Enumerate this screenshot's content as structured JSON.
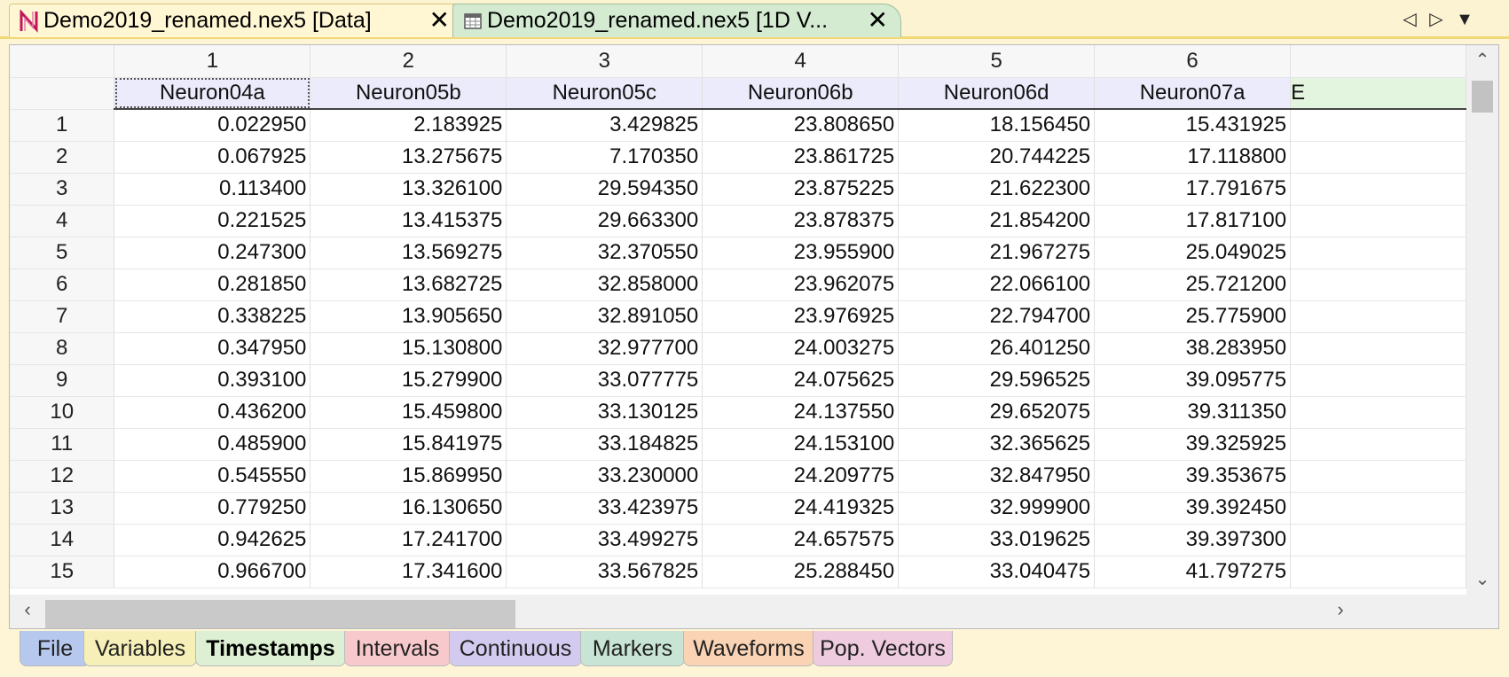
{
  "document_tabs": [
    {
      "label": "Demo2019_renamed.nex5 [Data]",
      "close": "✕",
      "icon": "neuroexplorer-logo-icon"
    },
    {
      "label": "Demo2019_renamed.nex5 [1D V...",
      "close": "✕",
      "icon": "table-window-icon"
    }
  ],
  "tab_nav": {
    "prev": "◁",
    "next": "▷",
    "menu": "▼"
  },
  "grid": {
    "column_numbers": [
      "1",
      "2",
      "3",
      "4",
      "5",
      "6"
    ],
    "column_names": [
      "Neuron04a",
      "Neuron05b",
      "Neuron05c",
      "Neuron06b",
      "Neuron06d",
      "Neuron07a",
      "E"
    ],
    "rows": [
      {
        "n": "1",
        "v": [
          "0.022950",
          "2.183925",
          "3.429825",
          "23.808650",
          "18.156450",
          "15.431925"
        ]
      },
      {
        "n": "2",
        "v": [
          "0.067925",
          "13.275675",
          "7.170350",
          "23.861725",
          "20.744225",
          "17.118800"
        ]
      },
      {
        "n": "3",
        "v": [
          "0.113400",
          "13.326100",
          "29.594350",
          "23.875225",
          "21.622300",
          "17.791675"
        ]
      },
      {
        "n": "4",
        "v": [
          "0.221525",
          "13.415375",
          "29.663300",
          "23.878375",
          "21.854200",
          "17.817100"
        ]
      },
      {
        "n": "5",
        "v": [
          "0.247300",
          "13.569275",
          "32.370550",
          "23.955900",
          "21.967275",
          "25.049025"
        ]
      },
      {
        "n": "6",
        "v": [
          "0.281850",
          "13.682725",
          "32.858000",
          "23.962075",
          "22.066100",
          "25.721200"
        ]
      },
      {
        "n": "7",
        "v": [
          "0.338225",
          "13.905650",
          "32.891050",
          "23.976925",
          "22.794700",
          "25.775900"
        ]
      },
      {
        "n": "8",
        "v": [
          "0.347950",
          "15.130800",
          "32.977700",
          "24.003275",
          "26.401250",
          "38.283950"
        ]
      },
      {
        "n": "9",
        "v": [
          "0.393100",
          "15.279900",
          "33.077775",
          "24.075625",
          "29.596525",
          "39.095775"
        ]
      },
      {
        "n": "10",
        "v": [
          "0.436200",
          "15.459800",
          "33.130125",
          "24.137550",
          "29.652075",
          "39.311350"
        ]
      },
      {
        "n": "11",
        "v": [
          "0.485900",
          "15.841975",
          "33.184825",
          "24.153100",
          "32.365625",
          "39.325925"
        ]
      },
      {
        "n": "12",
        "v": [
          "0.545550",
          "15.869950",
          "33.230000",
          "24.209775",
          "32.847950",
          "39.353675"
        ]
      },
      {
        "n": "13",
        "v": [
          "0.779250",
          "16.130650",
          "33.423975",
          "24.419325",
          "32.999900",
          "39.392450"
        ]
      },
      {
        "n": "14",
        "v": [
          "0.942625",
          "17.241700",
          "33.499275",
          "24.657575",
          "33.019625",
          "39.397300"
        ]
      },
      {
        "n": "15",
        "v": [
          "0.966700",
          "17.341600",
          "33.567825",
          "25.288450",
          "33.040475",
          "41.797275"
        ]
      }
    ]
  },
  "scroll": {
    "up": "⌃",
    "down": "⌄",
    "left": "‹",
    "right": "›"
  },
  "bottom_tabs": [
    {
      "label": "File",
      "color": "#b6c8ee",
      "active": false
    },
    {
      "label": "Variables",
      "color": "#f6f0b8",
      "active": false
    },
    {
      "label": "Timestamps",
      "color": "#ddf0d4",
      "active": true
    },
    {
      "label": "Intervals",
      "color": "#f8c9cc",
      "active": false
    },
    {
      "label": "Continuous",
      "color": "#d3cbef",
      "active": false
    },
    {
      "label": "Markers",
      "color": "#c7e4d4",
      "active": false
    },
    {
      "label": "Waveforms",
      "color": "#f9d3b4",
      "active": false
    },
    {
      "label": "Pop. Vectors",
      "color": "#efcbe0",
      "active": false
    }
  ]
}
